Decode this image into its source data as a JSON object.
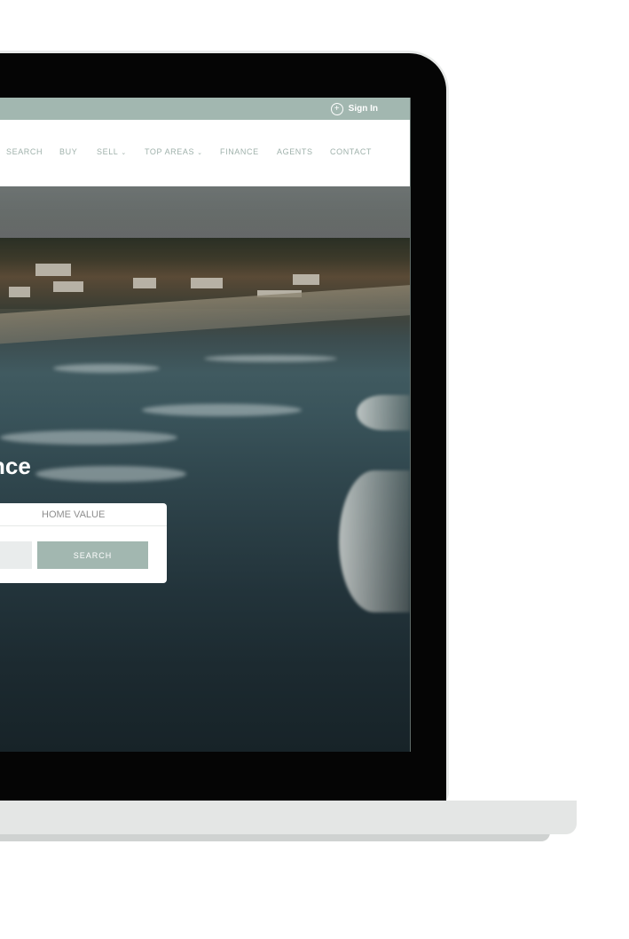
{
  "topbar": {
    "signin_label": "Sign In",
    "signin_icon": "plus-circle-icon"
  },
  "nav": {
    "items": [
      {
        "label": "SEARCH",
        "dropdown": false
      },
      {
        "label": "BUY",
        "dropdown": false
      },
      {
        "label": "SELL",
        "dropdown": true
      },
      {
        "label": "TOP AREAS",
        "dropdown": true
      },
      {
        "label": "FINANCE",
        "dropdown": false
      },
      {
        "label": "AGENTS",
        "dropdown": false
      },
      {
        "label": "CONTACT",
        "dropdown": false
      }
    ],
    "caret": "⌄"
  },
  "hero": {
    "heading_partial": "nce"
  },
  "search": {
    "tab_label": "HOME VALUE",
    "input_value": "",
    "button_label": "SEARCH"
  },
  "colors": {
    "accent": "#a2b7b0",
    "nav_text": "#9fb1ab",
    "frame": "#050505"
  }
}
